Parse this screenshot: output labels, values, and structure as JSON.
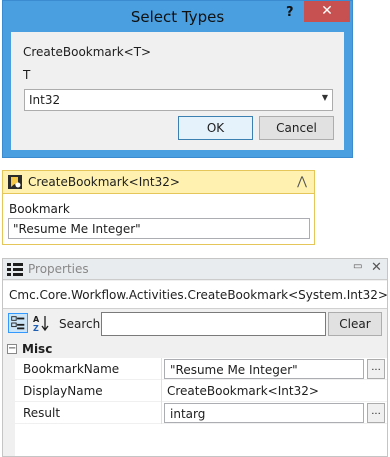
{
  "dialog": {
    "title": "Select Types",
    "help_label": "?",
    "close_label": "✕",
    "type_label": "CreateBookmark<T>",
    "param_label": "T",
    "selected_type": "Int32",
    "ok_label": "OK",
    "cancel_label": "Cancel"
  },
  "activity": {
    "title": "CreateBookmark<Int32>",
    "collapse_icon": "⋀",
    "bookmark_label": "Bookmark",
    "bookmark_value": "\"Resume Me Integer\""
  },
  "properties": {
    "title": "Properties",
    "pin_icon": "▭",
    "close_icon": "✕",
    "type_name": "Cmc.Core.Workflow.Activities.CreateBookmark<System.Int32>",
    "search_label": "Search:",
    "search_value": "",
    "clear_label": "Clear",
    "category": {
      "toggle": "−",
      "label": "Misc"
    },
    "rows": [
      {
        "name": "BookmarkName",
        "value": "\"Resume Me Integer\"",
        "button": "..."
      },
      {
        "name": "DisplayName",
        "value": "CreateBookmark<Int32>"
      },
      {
        "name": "Result",
        "value": "intarg",
        "button": "..."
      }
    ]
  },
  "colors": {
    "dialog_frame": "#4a9fe0",
    "close_button": "#c75050",
    "activity_header": "#fff2b0",
    "activity_border": "#e4c65a"
  }
}
